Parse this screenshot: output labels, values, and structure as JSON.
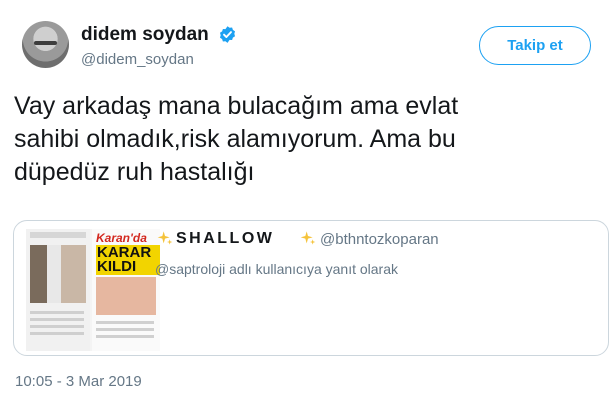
{
  "user": {
    "display_name": "didem soydan",
    "handle": "@didem_soydan",
    "verified": true
  },
  "follow_button_label": "Takip et",
  "tweet_text": "Vay arkadaş mana bulacağım ama  evlat\nsahibi olmadık,risk alamıyorum. Ama bu\ndüpedüz ruh hastalığı",
  "quoted_tweet": {
    "display_name": "SHALLOW",
    "handle": "@bthntozkoparan",
    "reply_context": "@saptroloji adlı kullanıcıya yanıt olarak",
    "thumbnail": {
      "brand_text": "Karan'da",
      "headline": "KARAR KILDI"
    }
  },
  "timestamp": "10:05 - 3 Mar 2019",
  "colors": {
    "accent": "#1da1f2",
    "secondary_text": "#657786",
    "border": "#ccd6dd",
    "sparkle": "#f5c33b"
  }
}
